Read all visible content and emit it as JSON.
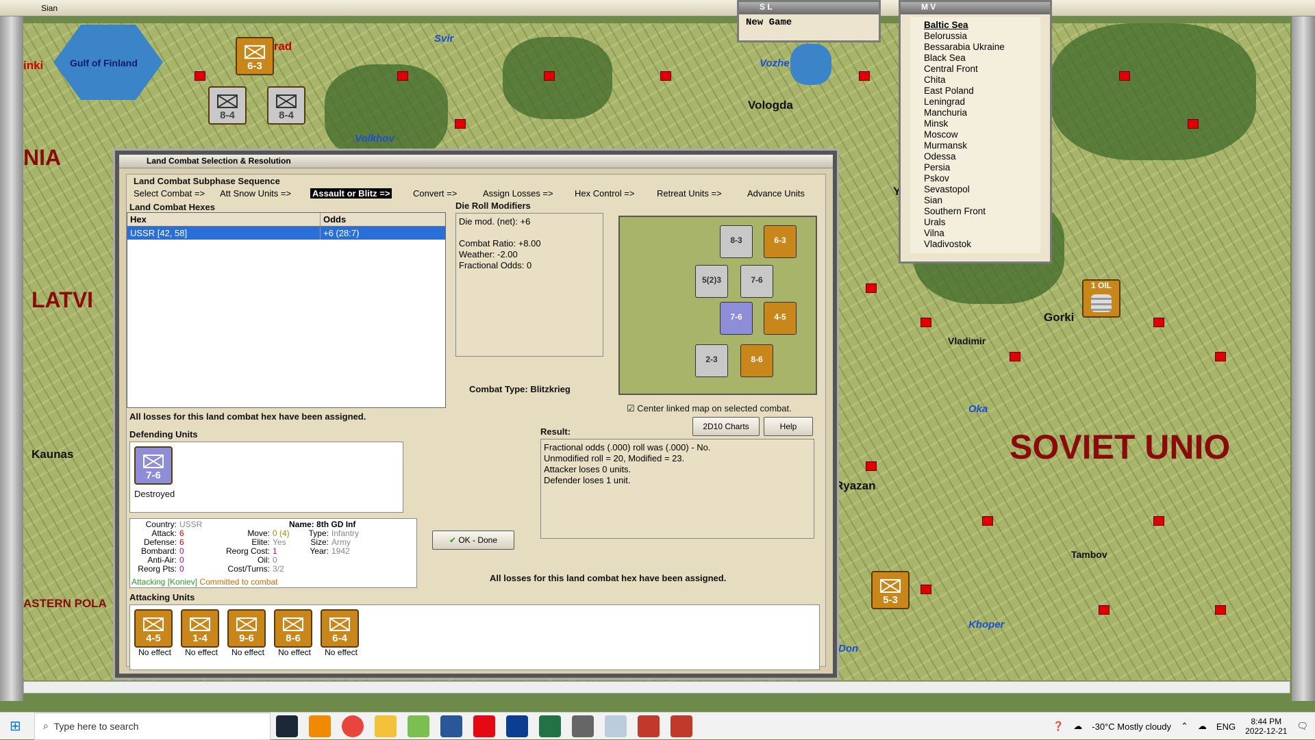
{
  "window": {
    "title": "Sian"
  },
  "map": {
    "sea": "Gulf of Finland",
    "cities": [
      "Leningrad",
      "Vologda",
      "Yaro",
      "Gorki",
      "Vladimir",
      "Ryazan",
      "Tambov",
      "Kaunas",
      "inki"
    ],
    "rivers": [
      "Svir",
      "Volkhov",
      "Vozhe",
      "Oka",
      "Khoper",
      "Don"
    ],
    "regions": [
      "NIA",
      "LATVI",
      "SOVIET UNIO",
      "ASTERN POLA"
    ],
    "oil": "1 OIL",
    "units": [
      {
        "val": "6-3"
      },
      {
        "val": "8-4"
      },
      {
        "val": "8-4"
      },
      {
        "val": "5-3"
      }
    ]
  },
  "sl_window": {
    "title": "S L",
    "item": "New Game"
  },
  "mv_window": {
    "title": "M V",
    "items": [
      "Baltic Sea",
      "Belorussia",
      "Bessarabia Ukraine",
      "Black Sea",
      "Central Front",
      "Chita",
      "East Poland",
      "Leningrad",
      "Manchuria",
      "Minsk",
      "Moscow",
      "Murmansk",
      "Odessa",
      "Persia",
      "Pskov",
      "Sevastopol",
      "Sian",
      "Southern Front",
      "Urals",
      "Vilna",
      "Vladivostok"
    ]
  },
  "dialog": {
    "title": "Land Combat Selection & Resolution",
    "sequence_label": "Land Combat Subphase Sequence",
    "phases": [
      "Select Combat =>",
      "Att Snow Units =>",
      "Assault or Blitz =>",
      "Convert =>",
      "Assign Losses =>",
      "Hex Control =>",
      "Retreat Units =>",
      "Advance Units"
    ],
    "hexes_label": "Land Combat Hexes",
    "col_hex": "Hex",
    "col_odds": "Odds",
    "row_hex": "USSR [42, 58]",
    "row_odds": "+6 (28:7)",
    "drm_label": "Die Roll Modifiers",
    "drm_lines": [
      "Die mod. (net): +6",
      "",
      "Combat Ratio: +8.00",
      "Weather: -2.00",
      "Fractional Odds: 0"
    ],
    "combat_type": "Combat Type:  Blitzkrieg",
    "center_map": "Center linked map on selected combat.",
    "charts_btn": "2D10 Charts",
    "help_btn": "Help",
    "losses_msg": "All losses for this land combat hex have been assigned.",
    "defending_label": "Defending Units",
    "defender": {
      "val": "7-6",
      "status": "Destroyed"
    },
    "result_label": "Result:",
    "result_lines": [
      "Fractional odds (.000) roll was (.000)  - No.",
      "Unmodified roll = 20, Modified = 23.",
      "Attacker loses 0 units.",
      "Defender loses 1 unit."
    ],
    "info": {
      "country_k": "Country:",
      "country_v": "USSR",
      "name_k": "Name:",
      "name_v": "8th GD Inf",
      "attack_k": "Attack:",
      "attack_v": "6",
      "defense_k": "Defense:",
      "defense_v": "6",
      "bombard_k": "Bombard:",
      "bombard_v": "0",
      "antiair_k": "Anti-Air:",
      "antiair_v": "0",
      "reorgpts_k": "Reorg Pts:",
      "reorgpts_v": "0",
      "move_k": "Move:",
      "move_v": "0 (4)",
      "elite_k": "Elite:",
      "elite_v": "Yes",
      "reorgcost_k": "Reorg Cost:",
      "reorgcost_v": "1",
      "oil_k": "Oil:",
      "oil_v": "0",
      "costturns_k": "Cost/Turns:",
      "costturns_v": "3/2",
      "type_k": "Type:",
      "type_v": "Infantry",
      "size_k": "Size:",
      "size_v": "Army",
      "year_k": "Year:",
      "year_v": "1942",
      "attacking": "Attacking [Koniev]",
      "committed": "Committed to combat"
    },
    "ok_btn": "OK - Done",
    "attacking_label": "Attacking Units",
    "attackers": [
      {
        "val": "4-5",
        "status": "No effect"
      },
      {
        "val": "1-4",
        "status": "No effect"
      },
      {
        "val": "9-6",
        "status": "No effect"
      },
      {
        "val": "8-6",
        "status": "No effect"
      },
      {
        "val": "6-4",
        "status": "No effect"
      }
    ],
    "minimap_units": [
      "8-3",
      "6-3",
      "5(2)3",
      "7-6",
      "4-5",
      "7-6",
      "2-3",
      "8-6"
    ]
  },
  "taskbar": {
    "search": "Type here to search",
    "weather": "-30°C  Mostly cloudy",
    "lang": "ENG",
    "time": "8:44 PM",
    "date": "2022-12-21"
  }
}
